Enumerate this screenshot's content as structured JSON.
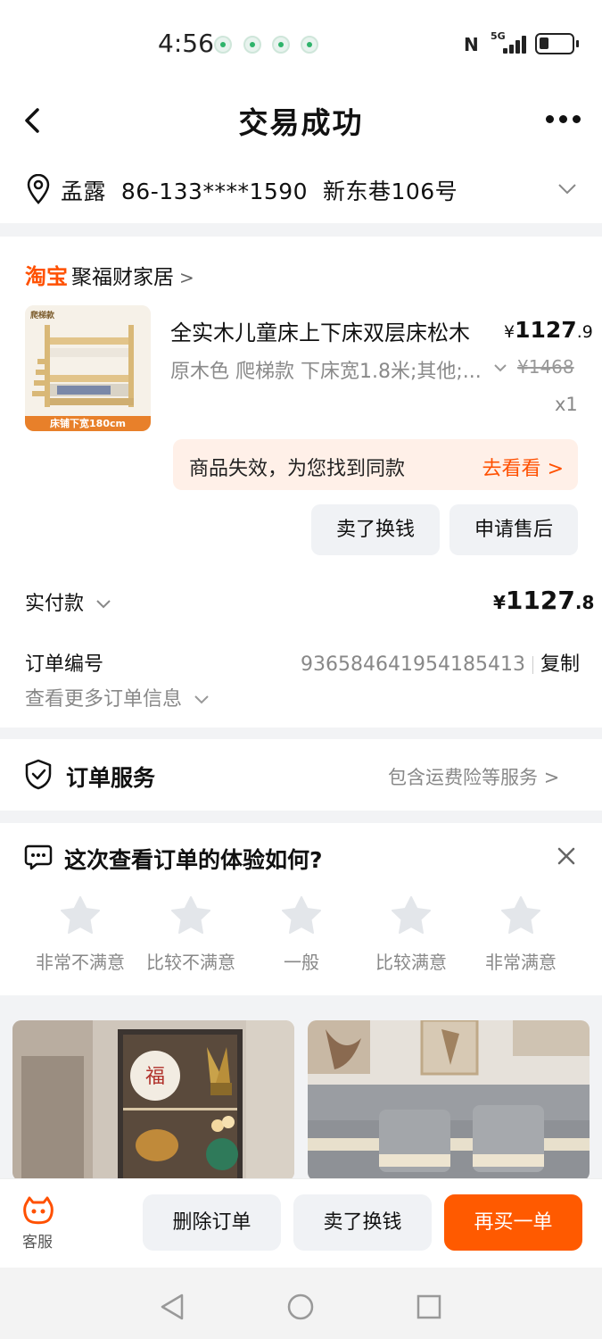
{
  "status_bar": {
    "time": "4:56",
    "network": "5G",
    "nfc": "N"
  },
  "header": {
    "title": "交易成功"
  },
  "address": {
    "text": "孟露  86-133****1590  新东巷106号"
  },
  "shop": {
    "logo": "淘宝",
    "name": "聚福财家居"
  },
  "product": {
    "thumb_tag": "爬梯款",
    "thumb_band": "床铺下宽180cm",
    "title": "全实木儿童床上下床双层床松木",
    "price_main": "1127",
    "price_decimal": ".9",
    "price_symbol": "¥",
    "sku": "原木色 爬梯款 下床宽1.8米;其他;...",
    "original_price": "¥1468",
    "quantity": "x1"
  },
  "notice": {
    "text": "商品失效，为您找到同款",
    "link": "去看看"
  },
  "item_actions": {
    "sell": "卖了换钱",
    "after_sale": "申请售后"
  },
  "payment": {
    "label": "实付款",
    "symbol": "¥",
    "main": "1127",
    "decimal": ".8"
  },
  "order": {
    "number_label": "订单编号",
    "number": "936584641954185413",
    "copy": "复制",
    "more_info": "查看更多订单信息"
  },
  "service": {
    "title": "订单服务",
    "desc": "包含运费险等服务"
  },
  "survey": {
    "title": "这次查看订单的体验如何?",
    "options": [
      "非常不满意",
      "比较不满意",
      "一般",
      "比较满意",
      "非常满意"
    ]
  },
  "bottom_bar": {
    "customer_service": "客服",
    "delete": "删除订单",
    "sell": "卖了换钱",
    "rebuy": "再买一单"
  },
  "colors": {
    "accent": "#ff5000",
    "notice_bg": "#fff0e8",
    "button_bg": "#f0f2f5"
  }
}
